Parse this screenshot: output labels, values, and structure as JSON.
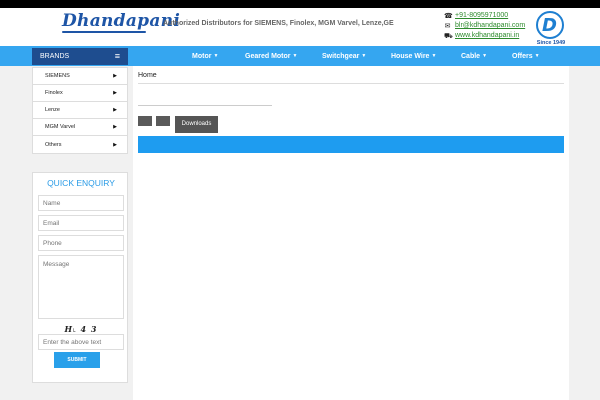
{
  "header": {
    "logo_text": "Dhandapani",
    "tagline": "Authorized Distributors for SIEMENS, Finolex, MGM Varvel, Lenze,GE",
    "phone": "+91-8095971000",
    "email": "blr@kdhandapani.com",
    "website": "www.kdhandapani.in",
    "badge_since": "Since 1949"
  },
  "sidebar": {
    "heading": "BRANDS",
    "items": [
      {
        "label": "SIEMENS"
      },
      {
        "label": "Finolex"
      },
      {
        "label": "Lenze"
      },
      {
        "label": "MGM Varvel"
      },
      {
        "label": "Others"
      }
    ]
  },
  "nav": {
    "items": [
      {
        "label": "Motor"
      },
      {
        "label": "Geared Motor"
      },
      {
        "label": "Switchgear"
      },
      {
        "label": "House Wire"
      },
      {
        "label": "Cable"
      },
      {
        "label": "Offers"
      }
    ]
  },
  "enquiry": {
    "title": "QUICK ENQUIRY",
    "name_placeholder": "Name",
    "email_placeholder": "Email",
    "phone_placeholder": "Phone",
    "message_placeholder": "Message",
    "captcha_text": "H˪ 4 3",
    "captcha_placeholder": "Enter the above text",
    "submit_label": "SUBMIT"
  },
  "content": {
    "breadcrumb": "Home",
    "downloads_label": "Downloads"
  },
  "colors": {
    "nav_blue": "#35a6f0",
    "brands_header": "#1e4d8f",
    "accent_blue": "#1e9cf0",
    "link_green": "#2e8b2e"
  }
}
